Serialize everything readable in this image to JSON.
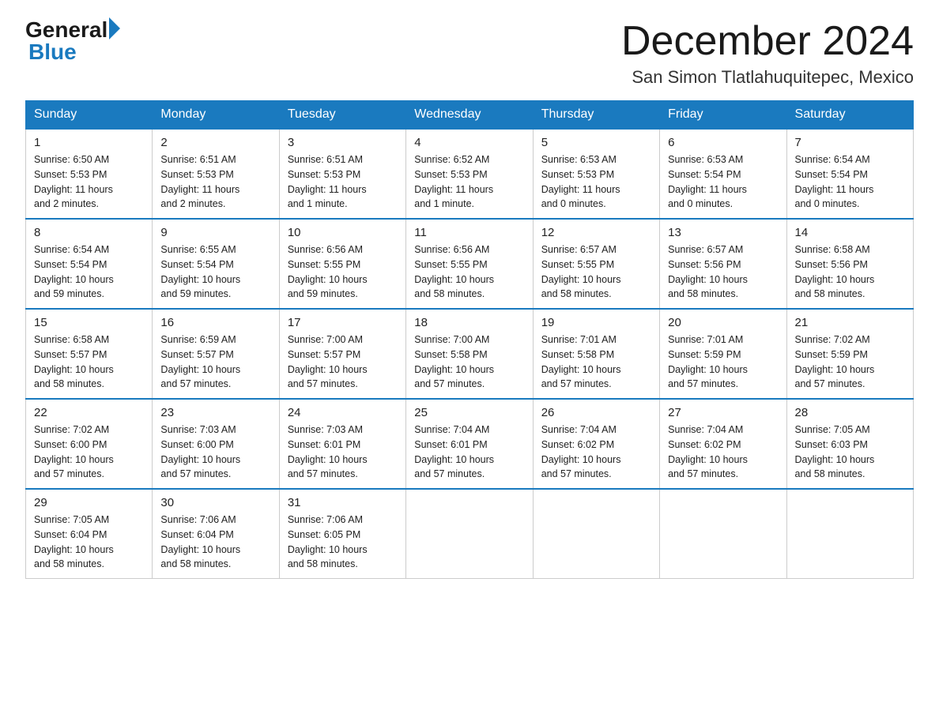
{
  "header": {
    "logo_general": "General",
    "logo_blue": "Blue",
    "month_title": "December 2024",
    "location": "San Simon Tlatlahuquitepec, Mexico"
  },
  "days_of_week": [
    "Sunday",
    "Monday",
    "Tuesday",
    "Wednesday",
    "Thursday",
    "Friday",
    "Saturday"
  ],
  "weeks": [
    [
      {
        "day": "1",
        "sunrise": "6:50 AM",
        "sunset": "5:53 PM",
        "daylight": "11 hours and 2 minutes."
      },
      {
        "day": "2",
        "sunrise": "6:51 AM",
        "sunset": "5:53 PM",
        "daylight": "11 hours and 2 minutes."
      },
      {
        "day": "3",
        "sunrise": "6:51 AM",
        "sunset": "5:53 PM",
        "daylight": "11 hours and 1 minute."
      },
      {
        "day": "4",
        "sunrise": "6:52 AM",
        "sunset": "5:53 PM",
        "daylight": "11 hours and 1 minute."
      },
      {
        "day": "5",
        "sunrise": "6:53 AM",
        "sunset": "5:53 PM",
        "daylight": "11 hours and 0 minutes."
      },
      {
        "day": "6",
        "sunrise": "6:53 AM",
        "sunset": "5:54 PM",
        "daylight": "11 hours and 0 minutes."
      },
      {
        "day": "7",
        "sunrise": "6:54 AM",
        "sunset": "5:54 PM",
        "daylight": "11 hours and 0 minutes."
      }
    ],
    [
      {
        "day": "8",
        "sunrise": "6:54 AM",
        "sunset": "5:54 PM",
        "daylight": "10 hours and 59 minutes."
      },
      {
        "day": "9",
        "sunrise": "6:55 AM",
        "sunset": "5:54 PM",
        "daylight": "10 hours and 59 minutes."
      },
      {
        "day": "10",
        "sunrise": "6:56 AM",
        "sunset": "5:55 PM",
        "daylight": "10 hours and 59 minutes."
      },
      {
        "day": "11",
        "sunrise": "6:56 AM",
        "sunset": "5:55 PM",
        "daylight": "10 hours and 58 minutes."
      },
      {
        "day": "12",
        "sunrise": "6:57 AM",
        "sunset": "5:55 PM",
        "daylight": "10 hours and 58 minutes."
      },
      {
        "day": "13",
        "sunrise": "6:57 AM",
        "sunset": "5:56 PM",
        "daylight": "10 hours and 58 minutes."
      },
      {
        "day": "14",
        "sunrise": "6:58 AM",
        "sunset": "5:56 PM",
        "daylight": "10 hours and 58 minutes."
      }
    ],
    [
      {
        "day": "15",
        "sunrise": "6:58 AM",
        "sunset": "5:57 PM",
        "daylight": "10 hours and 58 minutes."
      },
      {
        "day": "16",
        "sunrise": "6:59 AM",
        "sunset": "5:57 PM",
        "daylight": "10 hours and 57 minutes."
      },
      {
        "day": "17",
        "sunrise": "7:00 AM",
        "sunset": "5:57 PM",
        "daylight": "10 hours and 57 minutes."
      },
      {
        "day": "18",
        "sunrise": "7:00 AM",
        "sunset": "5:58 PM",
        "daylight": "10 hours and 57 minutes."
      },
      {
        "day": "19",
        "sunrise": "7:01 AM",
        "sunset": "5:58 PM",
        "daylight": "10 hours and 57 minutes."
      },
      {
        "day": "20",
        "sunrise": "7:01 AM",
        "sunset": "5:59 PM",
        "daylight": "10 hours and 57 minutes."
      },
      {
        "day": "21",
        "sunrise": "7:02 AM",
        "sunset": "5:59 PM",
        "daylight": "10 hours and 57 minutes."
      }
    ],
    [
      {
        "day": "22",
        "sunrise": "7:02 AM",
        "sunset": "6:00 PM",
        "daylight": "10 hours and 57 minutes."
      },
      {
        "day": "23",
        "sunrise": "7:03 AM",
        "sunset": "6:00 PM",
        "daylight": "10 hours and 57 minutes."
      },
      {
        "day": "24",
        "sunrise": "7:03 AM",
        "sunset": "6:01 PM",
        "daylight": "10 hours and 57 minutes."
      },
      {
        "day": "25",
        "sunrise": "7:04 AM",
        "sunset": "6:01 PM",
        "daylight": "10 hours and 57 minutes."
      },
      {
        "day": "26",
        "sunrise": "7:04 AM",
        "sunset": "6:02 PM",
        "daylight": "10 hours and 57 minutes."
      },
      {
        "day": "27",
        "sunrise": "7:04 AM",
        "sunset": "6:02 PM",
        "daylight": "10 hours and 57 minutes."
      },
      {
        "day": "28",
        "sunrise": "7:05 AM",
        "sunset": "6:03 PM",
        "daylight": "10 hours and 58 minutes."
      }
    ],
    [
      {
        "day": "29",
        "sunrise": "7:05 AM",
        "sunset": "6:04 PM",
        "daylight": "10 hours and 58 minutes."
      },
      {
        "day": "30",
        "sunrise": "7:06 AM",
        "sunset": "6:04 PM",
        "daylight": "10 hours and 58 minutes."
      },
      {
        "day": "31",
        "sunrise": "7:06 AM",
        "sunset": "6:05 PM",
        "daylight": "10 hours and 58 minutes."
      },
      null,
      null,
      null,
      null
    ]
  ],
  "labels": {
    "sunrise": "Sunrise:",
    "sunset": "Sunset:",
    "daylight": "Daylight:"
  }
}
